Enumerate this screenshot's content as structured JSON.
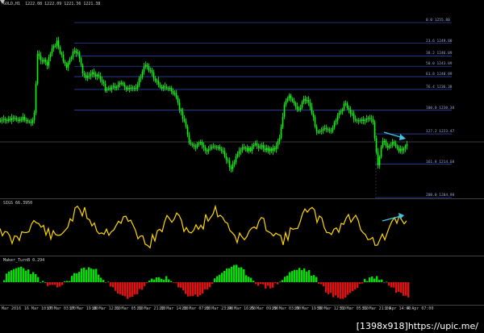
{
  "panes": {
    "main_title": "GOLD,H1  1222.08 1222.09 1221.36 1221.38",
    "osc_title": "SIGS 66.3950",
    "hist_title": "Maker_TurnB 0.294"
  },
  "fib_levels": [
    {
      "label": "0.0 1255.80",
      "price": 1255.8
    },
    {
      "label": "23.6 1249.80",
      "price": 1249.8
    },
    {
      "label": "38.2 1246.09",
      "price": 1246.09
    },
    {
      "label": "50.0 1243.09",
      "price": 1243.09
    },
    {
      "label": "61.8 1240.09",
      "price": 1240.09
    },
    {
      "label": "76.4 1236.38",
      "price": 1236.38
    },
    {
      "label": "100.0 1230.38",
      "price": 1230.38
    },
    {
      "label": "127.2 1223.47",
      "price": 1223.47
    },
    {
      "label": "161.8 1214.68",
      "price": 1214.68
    },
    {
      "label": "200.0 1204.98",
      "price": 1204.98
    }
  ],
  "time_axis": [
    "Mar 2016",
    "16 Mar 10:00",
    "17 Mar 03:00",
    "17 Mar 19:00",
    "18 Mar 12:00",
    "21 Mar 05:00",
    "21 Mar 21:00",
    "22 Mar 14:00",
    "23 Mar 07:00",
    "23 Mar 23:00",
    "24 Mar 16:00",
    "25 Mar 09:00",
    "29 Mar 03:00",
    "29 Mar 19:00",
    "30 Mar 12:00",
    "31 Mar 05:00",
    "31 Mar 21:00",
    "1 Apr 14:00",
    "4 Apr 07:00"
  ],
  "colors": {
    "background": "#000000",
    "candle": "#00ff00",
    "fib_line": "#2b3fa6",
    "osc_line": "#ffd700",
    "hist_up": "#00e000",
    "hist_down": "#e01010",
    "arrow": "#3fc7e8"
  },
  "watermark": "[1398x918]https://upic.me/"
}
